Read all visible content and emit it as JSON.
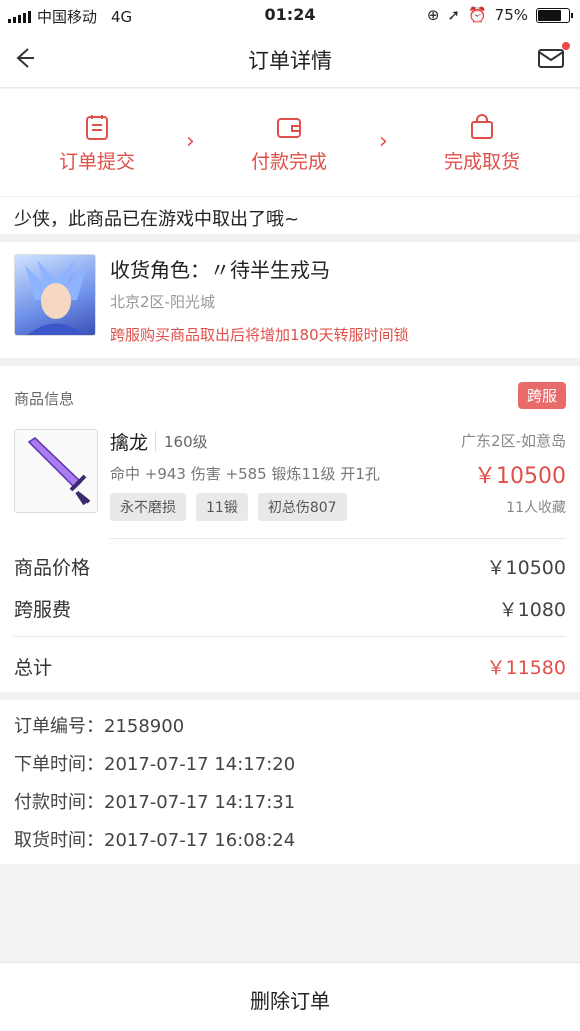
{
  "status": {
    "carrier": "中国移动",
    "network": "4G",
    "time": "01:24",
    "battery": "75%"
  },
  "nav": {
    "title": "订单详情"
  },
  "steps": [
    {
      "label": "订单提交"
    },
    {
      "label": "付款完成"
    },
    {
      "label": "完成取货"
    }
  ],
  "notice": "少侠，此商品已在游戏中取出了哦~",
  "role": {
    "name": "收货角色：〃待半生戎马",
    "server": "北京2区-阳光城",
    "warning": "跨服购买商品取出后将增加180天转服时间锁"
  },
  "goods": {
    "section_title": "商品信息",
    "tag": "跨服",
    "item": {
      "name": "擒龙",
      "level": "160级",
      "server": "广东2区-如意岛",
      "stats": "命中 +943 伤害 +585 锻炼11级 开1孔",
      "price": "￥10500",
      "chips": [
        "永不磨损",
        "11锻",
        "初总伤807"
      ],
      "favorites": "11人收藏"
    },
    "price_label": "商品价格",
    "price_value": "￥10500",
    "fee_label": "跨服费",
    "fee_value": "￥1080",
    "total_label": "总计",
    "total_value": "￥11580"
  },
  "order": {
    "number": "订单编号：2158900",
    "created": "下单时间：2017-07-17 14:17:20",
    "paid": "付款时间：2017-07-17 14:17:31",
    "picked": "取货时间：2017-07-17 16:08:24"
  },
  "bottom": {
    "delete": "删除订单"
  },
  "colors": {
    "accent": "#e0504a",
    "tag": "#e86a6a"
  }
}
